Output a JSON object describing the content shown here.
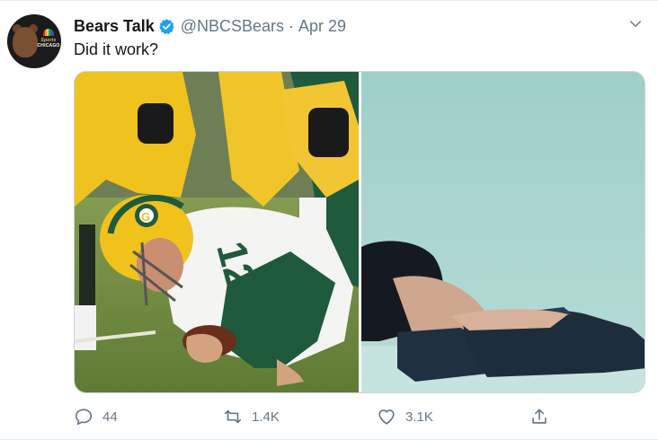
{
  "tweet": {
    "display_name": "Bears Talk",
    "handle": "@NBCSBears",
    "separator": "·",
    "date": "Apr 29",
    "text": "Did it work?"
  },
  "avatar": {
    "logo_line1": "Sports",
    "logo_line2": "CHICAGO"
  },
  "actions": {
    "replies": "44",
    "retweets": "1.4K",
    "likes": "3.1K"
  },
  "icons": {
    "verified": "verified-badge-icon",
    "caret": "chevron-down-icon",
    "reply": "reply-icon",
    "retweet": "retweet-icon",
    "like": "heart-icon",
    "share": "share-icon"
  },
  "colors": {
    "verified_blue": "#1da1f2",
    "muted_text": "#657786",
    "packers_green": "#1f5a3c",
    "packers_gold": "#f2c11a"
  }
}
